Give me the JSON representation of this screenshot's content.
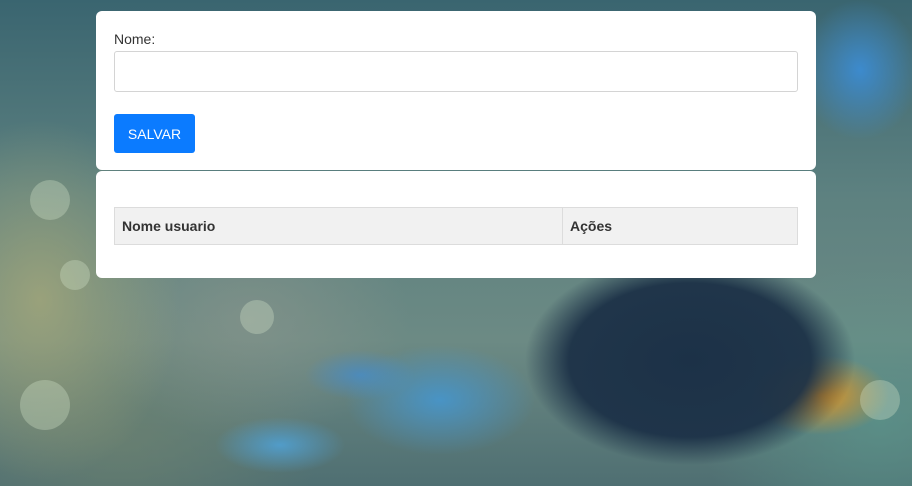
{
  "form": {
    "name_label": "Nome:",
    "name_value": "",
    "name_placeholder": "",
    "save_label": "SALVAR"
  },
  "table": {
    "columns": [
      "Nome usuario",
      "Ações"
    ],
    "rows": []
  },
  "colors": {
    "primary": "#0b7bff",
    "card_bg": "#ffffff",
    "table_header_bg": "#f1f1f1"
  }
}
